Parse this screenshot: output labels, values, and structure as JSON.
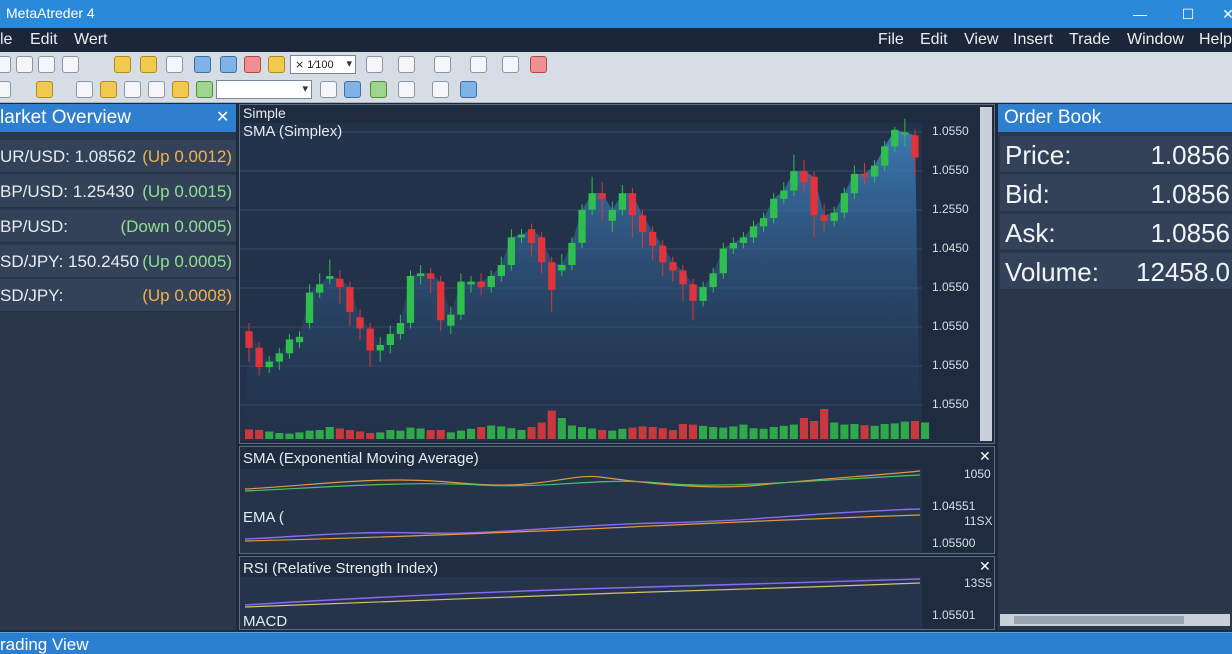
{
  "window": {
    "title": "MetaAtreder 4",
    "min": "—",
    "max": "☐",
    "close": "✕"
  },
  "menu_left": [
    "le",
    "Edit",
    "Wert"
  ],
  "menu_right": [
    "File",
    "Edit",
    "View",
    "Insert",
    "Trade",
    "Window",
    "Help"
  ],
  "toolbar1": {
    "combo_value": "⨯ 1⁄100"
  },
  "toolbar2": {
    "combo_value": ""
  },
  "market_overview": {
    "title": "larket Overview",
    "close": "✕",
    "rows": [
      {
        "symbol": "UR/USD: 1.08562",
        "change": "(Up 0.0012)",
        "color": "#f0b24a"
      },
      {
        "symbol": "BP/USD: 1.25430",
        "change": "(Up 0.0015)",
        "color": "#8fe08f"
      },
      {
        "symbol": "BP/USD:",
        "change": "(Down 0.0005)",
        "color": "#8fe08f"
      },
      {
        "symbol": "SD/JPY: 150.2450",
        "change": "(Up 0.0005)",
        "color": "#8fe08f"
      },
      {
        "symbol": "SD/JPY:",
        "change": "(Up 0.0008)",
        "color": "#f0b24a"
      }
    ]
  },
  "order_book": {
    "title": "Order Book",
    "rows": [
      {
        "label": "Price:",
        "value": "1.0856"
      },
      {
        "label": "Bid:",
        "value": "1.0856"
      },
      {
        "label": "Ask:",
        "value": "1.0856"
      },
      {
        "label": "Volume:",
        "value": "12458.0"
      }
    ]
  },
  "main_chart": {
    "tab": "Simple",
    "indicator": "SMA (Simplex)",
    "close": "✕",
    "y_labels": [
      "1.0550",
      "1.0550",
      "1.2550",
      "1.0450",
      "1.0550",
      "1.0550",
      "1.0550",
      "1.0550"
    ]
  },
  "ema_chart": {
    "title": "SMA (Exponential Moving Average)",
    "label2": "EMA (",
    "close": "✕",
    "y_labels": [
      "1050",
      "1.04551",
      "11SX",
      "1.05500"
    ]
  },
  "rsi_chart": {
    "title": "RSI (Relative Strength Index)",
    "label2": "MACD",
    "close": "✕",
    "y_labels": [
      "13S5",
      "1.05501"
    ]
  },
  "status": {
    "text": "rading View"
  },
  "colors": {
    "bull": "#2fbf4f",
    "bear": "#e0343a",
    "title_bar": "#2a89d8"
  },
  "chart_data": {
    "type": "candlestick",
    "candles": [
      {
        "o": 0.26,
        "c": 0.2,
        "h": 0.29,
        "l": 0.15
      },
      {
        "o": 0.2,
        "c": 0.13,
        "h": 0.22,
        "l": 0.1
      },
      {
        "o": 0.13,
        "c": 0.15,
        "h": 0.17,
        "l": 0.11
      },
      {
        "o": 0.15,
        "c": 0.18,
        "h": 0.2,
        "l": 0.12
      },
      {
        "o": 0.18,
        "c": 0.23,
        "h": 0.25,
        "l": 0.16
      },
      {
        "o": 0.22,
        "c": 0.24,
        "h": 0.26,
        "l": 0.2
      },
      {
        "o": 0.29,
        "c": 0.4,
        "h": 0.43,
        "l": 0.27
      },
      {
        "o": 0.4,
        "c": 0.43,
        "h": 0.47,
        "l": 0.38
      },
      {
        "o": 0.45,
        "c": 0.46,
        "h": 0.52,
        "l": 0.43
      },
      {
        "o": 0.45,
        "c": 0.42,
        "h": 0.48,
        "l": 0.36
      },
      {
        "o": 0.42,
        "c": 0.33,
        "h": 0.44,
        "l": 0.28
      },
      {
        "o": 0.31,
        "c": 0.27,
        "h": 0.34,
        "l": 0.23
      },
      {
        "o": 0.27,
        "c": 0.19,
        "h": 0.29,
        "l": 0.13
      },
      {
        "o": 0.19,
        "c": 0.21,
        "h": 0.24,
        "l": 0.15
      },
      {
        "o": 0.21,
        "c": 0.25,
        "h": 0.28,
        "l": 0.18
      },
      {
        "o": 0.25,
        "c": 0.29,
        "h": 0.32,
        "l": 0.23
      },
      {
        "o": 0.29,
        "c": 0.46,
        "h": 0.48,
        "l": 0.27
      },
      {
        "o": 0.46,
        "c": 0.47,
        "h": 0.5,
        "l": 0.43
      },
      {
        "o": 0.47,
        "c": 0.45,
        "h": 0.49,
        "l": 0.4
      },
      {
        "o": 0.44,
        "c": 0.3,
        "h": 0.46,
        "l": 0.26
      },
      {
        "o": 0.28,
        "c": 0.32,
        "h": 0.35,
        "l": 0.25
      },
      {
        "o": 0.32,
        "c": 0.44,
        "h": 0.47,
        "l": 0.3
      },
      {
        "o": 0.43,
        "c": 0.44,
        "h": 0.46,
        "l": 0.4
      },
      {
        "o": 0.44,
        "c": 0.42,
        "h": 0.47,
        "l": 0.39
      },
      {
        "o": 0.42,
        "c": 0.46,
        "h": 0.48,
        "l": 0.4
      },
      {
        "o": 0.46,
        "c": 0.5,
        "h": 0.53,
        "l": 0.44
      },
      {
        "o": 0.5,
        "c": 0.6,
        "h": 0.63,
        "l": 0.48
      },
      {
        "o": 0.6,
        "c": 0.61,
        "h": 0.63,
        "l": 0.58
      },
      {
        "o": 0.63,
        "c": 0.58,
        "h": 0.65,
        "l": 0.53
      },
      {
        "o": 0.6,
        "c": 0.51,
        "h": 0.62,
        "l": 0.47
      },
      {
        "o": 0.51,
        "c": 0.41,
        "h": 0.53,
        "l": 0.33
      },
      {
        "o": 0.48,
        "c": 0.5,
        "h": 0.54,
        "l": 0.46
      },
      {
        "o": 0.5,
        "c": 0.58,
        "h": 0.6,
        "l": 0.48
      },
      {
        "o": 0.58,
        "c": 0.7,
        "h": 0.72,
        "l": 0.56
      },
      {
        "o": 0.7,
        "c": 0.76,
        "h": 0.82,
        "l": 0.68
      },
      {
        "o": 0.76,
        "c": 0.74,
        "h": 0.8,
        "l": 0.66
      },
      {
        "o": 0.66,
        "c": 0.7,
        "h": 0.73,
        "l": 0.62
      },
      {
        "o": 0.7,
        "c": 0.76,
        "h": 0.79,
        "l": 0.68
      },
      {
        "o": 0.76,
        "c": 0.68,
        "h": 0.78,
        "l": 0.6
      },
      {
        "o": 0.68,
        "c": 0.62,
        "h": 0.7,
        "l": 0.56
      },
      {
        "o": 0.62,
        "c": 0.57,
        "h": 0.64,
        "l": 0.52
      },
      {
        "o": 0.57,
        "c": 0.51,
        "h": 0.59,
        "l": 0.46
      },
      {
        "o": 0.51,
        "c": 0.48,
        "h": 0.53,
        "l": 0.44
      },
      {
        "o": 0.48,
        "c": 0.43,
        "h": 0.5,
        "l": 0.37
      },
      {
        "o": 0.43,
        "c": 0.37,
        "h": 0.45,
        "l": 0.3
      },
      {
        "o": 0.37,
        "c": 0.42,
        "h": 0.44,
        "l": 0.35
      },
      {
        "o": 0.42,
        "c": 0.47,
        "h": 0.49,
        "l": 0.4
      },
      {
        "o": 0.47,
        "c": 0.56,
        "h": 0.58,
        "l": 0.45
      },
      {
        "o": 0.56,
        "c": 0.58,
        "h": 0.6,
        "l": 0.54
      },
      {
        "o": 0.58,
        "c": 0.6,
        "h": 0.62,
        "l": 0.56
      },
      {
        "o": 0.6,
        "c": 0.64,
        "h": 0.66,
        "l": 0.58
      },
      {
        "o": 0.64,
        "c": 0.67,
        "h": 0.69,
        "l": 0.62
      },
      {
        "o": 0.67,
        "c": 0.74,
        "h": 0.76,
        "l": 0.65
      },
      {
        "o": 0.74,
        "c": 0.77,
        "h": 0.8,
        "l": 0.72
      },
      {
        "o": 0.77,
        "c": 0.84,
        "h": 0.9,
        "l": 0.75
      },
      {
        "o": 0.84,
        "c": 0.8,
        "h": 0.88,
        "l": 0.76
      },
      {
        "o": 0.82,
        "c": 0.68,
        "h": 0.84,
        "l": 0.6
      },
      {
        "o": 0.68,
        "c": 0.66,
        "h": 0.72,
        "l": 0.62
      },
      {
        "o": 0.66,
        "c": 0.69,
        "h": 0.71,
        "l": 0.64
      },
      {
        "o": 0.69,
        "c": 0.76,
        "h": 0.78,
        "l": 0.67
      },
      {
        "o": 0.76,
        "c": 0.83,
        "h": 0.86,
        "l": 0.74
      },
      {
        "o": 0.83,
        "c": 0.82,
        "h": 0.87,
        "l": 0.79
      },
      {
        "o": 0.82,
        "c": 0.86,
        "h": 0.88,
        "l": 0.8
      },
      {
        "o": 0.86,
        "c": 0.93,
        "h": 0.95,
        "l": 0.84
      },
      {
        "o": 0.93,
        "c": 0.99,
        "h": 1.0,
        "l": 0.91
      },
      {
        "o": 0.98,
        "c": 0.98,
        "h": 1.03,
        "l": 0.93
      },
      {
        "o": 0.97,
        "c": 0.89,
        "h": 0.99,
        "l": 0.82
      }
    ],
    "volumes": [
      0.32,
      0.3,
      0.25,
      0.2,
      0.18,
      0.22,
      0.28,
      0.3,
      0.4,
      0.35,
      0.3,
      0.25,
      0.2,
      0.22,
      0.3,
      0.28,
      0.38,
      0.35,
      0.3,
      0.3,
      0.22,
      0.28,
      0.34,
      0.4,
      0.45,
      0.42,
      0.36,
      0.3,
      0.4,
      0.55,
      0.95,
      0.7,
      0.45,
      0.4,
      0.35,
      0.3,
      0.28,
      0.34,
      0.38,
      0.42,
      0.4,
      0.36,
      0.3,
      0.5,
      0.48,
      0.44,
      0.4,
      0.38,
      0.42,
      0.48,
      0.36,
      0.34,
      0.4,
      0.44,
      0.48,
      0.7,
      0.6,
      1.0,
      0.55,
      0.48,
      0.5,
      0.46,
      0.44,
      0.5,
      0.52,
      0.58,
      0.6,
      0.55
    ]
  }
}
